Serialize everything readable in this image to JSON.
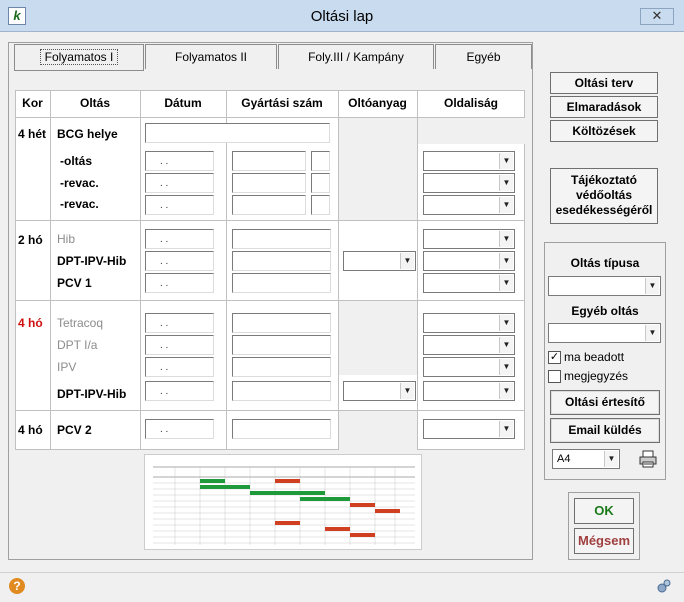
{
  "window": {
    "title": "Oltási lap",
    "close_glyph": "✕",
    "app_icon_text": "k"
  },
  "tabs": [
    "Folyamatos I",
    "Folyamatos II",
    "Foly.III / Kampány",
    "Egyéb"
  ],
  "columns": [
    "Kor",
    "Oltás",
    "Dátum",
    "Gyártási szám",
    "Oltóanyag",
    "Oldaliság"
  ],
  "groups": [
    {
      "age": "4 hét",
      "age_color": "#000000"
    },
    {
      "age": "2 hó",
      "age_color": "#000000"
    },
    {
      "age": "4 hó",
      "age_color": "#d01010"
    },
    {
      "age": "4 hó",
      "age_color": "#000000"
    }
  ],
  "vaccines": [
    "BCG helye",
    "-oltás",
    "-revac.",
    "-revac.",
    "Hib",
    "DPT-IPV-Hib",
    "PCV 1",
    "Tetracoq",
    "DPT I/a",
    "IPV",
    "DPT-IPV-Hib",
    "PCV 2"
  ],
  "date_placeholder": ". .",
  "right_buttons": {
    "oltasi_terv": "Oltási terv",
    "elmaradasok": "Elmaradások",
    "koltozesek": "Költözések",
    "tajekoztato_1": "Tájékoztató",
    "tajekoztato_2": "védőoltás",
    "tajekoztato_3": "esedékességéről"
  },
  "options_group": {
    "oltas_tipusa_label": "Oltás típusa",
    "egyeb_oltas_label": "Egyéb oltás",
    "ma_beadott_label": "ma beadott",
    "ma_beadott_checked": "✓",
    "megjegyzes_label": "megjegyzés",
    "ertesito_button": "Oltási értesítő",
    "email_button": "Email küldés",
    "paper_size": "A4",
    "print_icon": "printer-icon"
  },
  "dialog_buttons": {
    "ok": "OK",
    "cancel": "Mégsem"
  },
  "colors": {
    "ok_text": "#1a7a1a",
    "cancel_text": "#a04040",
    "titlebar": "#c9dbee",
    "red_age": "#d01010"
  },
  "status": {
    "help_glyph": "?"
  }
}
